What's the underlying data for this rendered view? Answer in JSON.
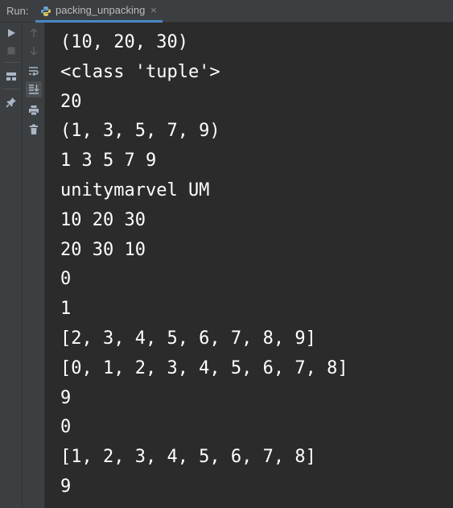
{
  "header": {
    "run_label": "Run:",
    "tab_label": "packing_unpacking",
    "tab_icon": "python-file-icon",
    "close_glyph": "×"
  },
  "toolbar_primary": [
    {
      "name": "rerun-icon",
      "enabled": true
    },
    {
      "name": "stop-icon",
      "enabled": false
    },
    {
      "name": "layout-icon",
      "enabled": true
    },
    {
      "name": "pin-icon",
      "enabled": true
    }
  ],
  "toolbar_secondary": [
    {
      "name": "scroll-up-icon",
      "enabled": false
    },
    {
      "name": "scroll-down-icon",
      "enabled": false
    },
    {
      "name": "soft-wrap-icon",
      "enabled": true
    },
    {
      "name": "scroll-to-end-icon",
      "enabled": true,
      "active": true
    },
    {
      "name": "print-icon",
      "enabled": true
    },
    {
      "name": "clear-all-icon",
      "enabled": true
    }
  ],
  "console": {
    "lines": [
      "(10, 20, 30)",
      "<class 'tuple'>",
      "20",
      "(1, 3, 5, 7, 9)",
      "1 3 5 7 9",
      "unitymarvel UM",
      "10 20 30",
      "20 30 10",
      "0",
      "1",
      "[2, 3, 4, 5, 6, 7, 8, 9]",
      "[0, 1, 2, 3, 4, 5, 6, 7, 8]",
      "9",
      "0",
      "[1, 2, 3, 4, 5, 6, 7, 8]",
      "9"
    ]
  },
  "colors": {
    "background": "#2b2b2b",
    "panel": "#3c3f41",
    "text": "#ffffff",
    "muted": "#bbbbbb",
    "accent": "#4a88c7"
  }
}
